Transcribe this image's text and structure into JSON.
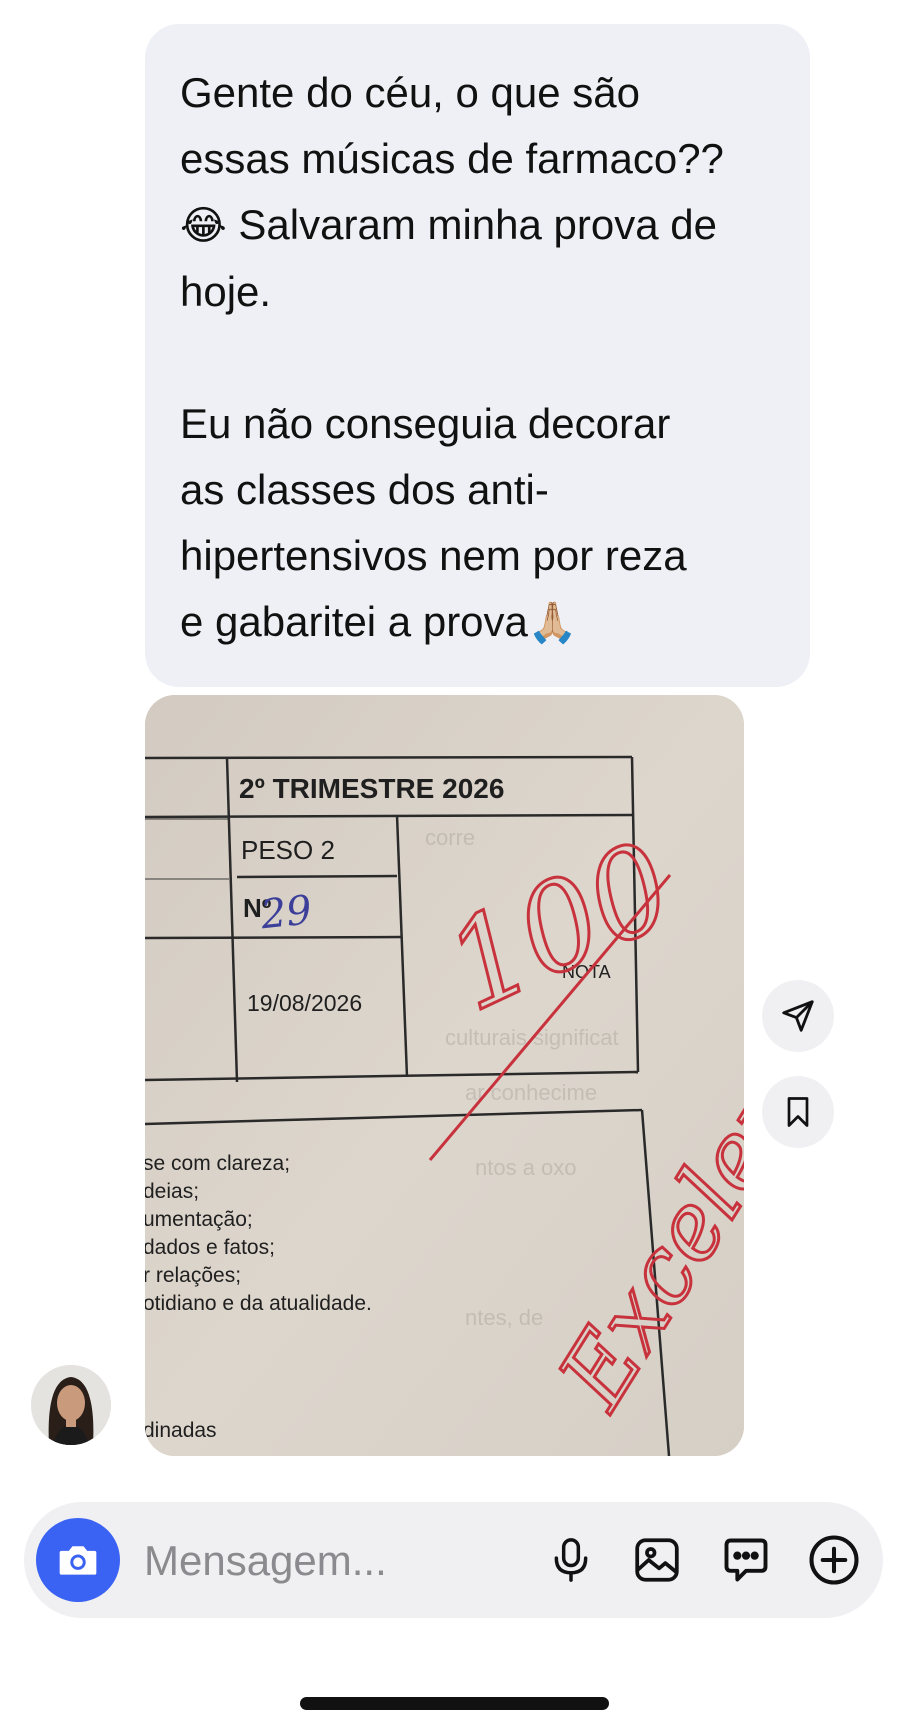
{
  "message": {
    "paragraph1": {
      "line1": "Gente do céu, o que são",
      "line2": "essas músicas de farmaco??",
      "emoji1": "😂",
      "line3": " Salvaram minha prova de",
      "line4": "hoje."
    },
    "paragraph2": {
      "line1": "Eu não conseguia decorar",
      "line2": "as classes dos anti-",
      "line3": "hipertensivos nem por reza",
      "line4": "e gabaritei a prova",
      "emoji2": "🙏🏼"
    }
  },
  "photo": {
    "header": "2º TRIMESTRE 2026",
    "peso": "PESO 2",
    "numero_label": "Nº",
    "numero_value": "29",
    "date": "19/08/2026",
    "nota_label": "NOTA",
    "grade": "100",
    "remark": "Excelente!",
    "list_lines": [
      "se com clareza;",
      "deias;",
      "umentação;",
      "dados e fatos;",
      "r relações;",
      "otidiano e da atualidade.",
      "dinadas"
    ],
    "colors": {
      "ink_red": "#c8323c",
      "ink_blue": "#3b3f9a",
      "paper": "#d9d1c7"
    }
  },
  "actions": {
    "share_icon": "paper-plane-icon",
    "save_icon": "bookmark-icon"
  },
  "composer": {
    "placeholder": "Mensagem...",
    "icons": [
      "camera-icon",
      "microphone-icon",
      "image-icon",
      "sticker-chat-icon",
      "plus-icon"
    ],
    "accent": "#3b63f3"
  }
}
